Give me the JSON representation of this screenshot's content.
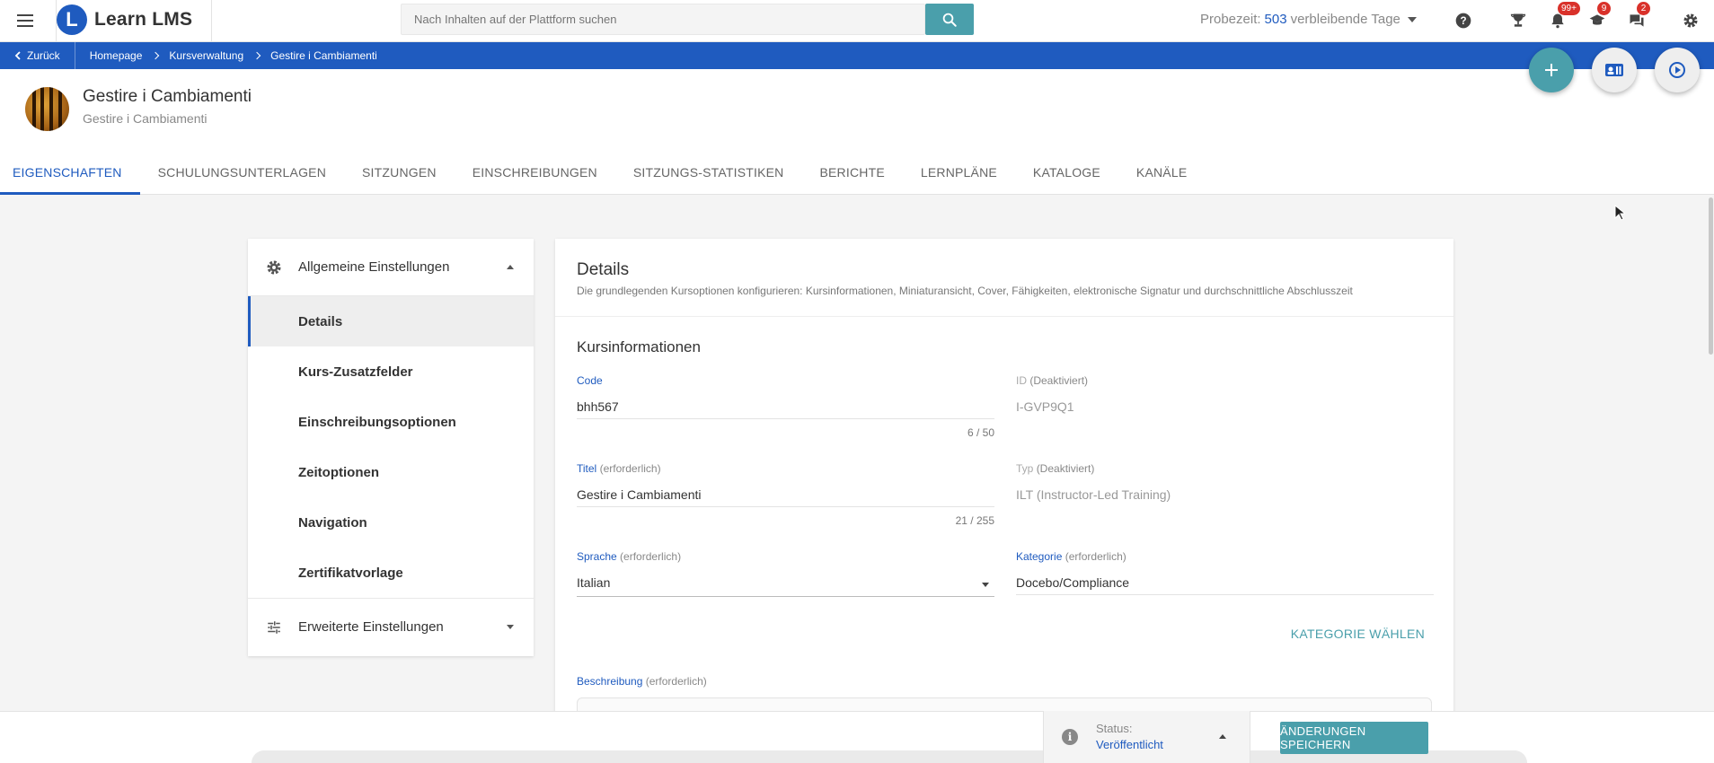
{
  "app": {
    "name": "Learn LMS",
    "logo_letter": "L",
    "brand_color": "#1f5bbf",
    "accent_color": "#4a9fab"
  },
  "topbar": {
    "search_placeholder": "Nach Inhalten auf der Plattform suchen",
    "trial_prefix": "Probezeit:",
    "trial_days": "503",
    "trial_suffix": "verbleibende Tage",
    "notifications_badge": "99+",
    "messages_badge": "9",
    "chat_badge": "2",
    "icons": [
      "menu-icon",
      "search-icon",
      "help-icon",
      "trophy-icon",
      "bell-icon",
      "graduation-icon",
      "chat-icon",
      "gear-icon"
    ]
  },
  "breadcrumb": {
    "back_label": "Zurück",
    "items": [
      "Homepage",
      "Kursverwaltung",
      "Gestire i Cambiamenti"
    ]
  },
  "course": {
    "title": "Gestire i Cambiamenti",
    "subtitle": "Gestire i Cambiamenti"
  },
  "tabs": [
    {
      "label": "EIGENSCHAFTEN",
      "active": true
    },
    {
      "label": "SCHULUNGSUNTERLAGEN"
    },
    {
      "label": "SITZUNGEN"
    },
    {
      "label": "EINSCHREIBUNGEN"
    },
    {
      "label": "SITZUNGS-STATISTIKEN"
    },
    {
      "label": "BERICHTE"
    },
    {
      "label": "LERNPLÄNE"
    },
    {
      "label": "KATALOGE"
    },
    {
      "label": "KANÄLE"
    }
  ],
  "sidebar": {
    "general_label": "Allgemeine Einstellungen",
    "items": [
      "Details",
      "Kurs-Zusatzfelder",
      "Einschreibungsoptionen",
      "Zeitoptionen",
      "Navigation",
      "Zertifikatvorlage"
    ],
    "advanced_label": "Erweiterte Einstellungen"
  },
  "details": {
    "title": "Details",
    "description": "Die grundlegenden Kursoptionen konfigurieren: Kursinformationen, Miniaturansicht, Cover, Fähigkeiten, elektronische Signatur und durchschnittliche Abschlusszeit",
    "section_title": "Kursinformationen",
    "code": {
      "label": "Code",
      "value": "bhh567",
      "counter": "6 / 50"
    },
    "id": {
      "label": "ID",
      "hint": "(Deaktiviert)",
      "value": "I-GVP9Q1"
    },
    "titel": {
      "label": "Titel",
      "hint": "(erforderlich)",
      "value": "Gestire i Cambiamenti",
      "counter": "21 / 255"
    },
    "typ": {
      "label": "Typ",
      "hint": "(Deaktiviert)",
      "value": "ILT (Instructor-Led Training)"
    },
    "sprache": {
      "label": "Sprache",
      "hint": "(erforderlich)",
      "value": "Italian"
    },
    "kategorie": {
      "label": "Kategorie",
      "hint": "(erforderlich)",
      "value": "Docebo/Compliance",
      "button": "KATEGORIE WÄHLEN"
    },
    "beschreibung": {
      "label": "Beschreibung",
      "hint": "(erforderlich)"
    }
  },
  "footer": {
    "status_label": "Status:",
    "status_value": "Veröffentlicht",
    "save_label": "ÄNDERUNGEN SPEICHERN"
  }
}
